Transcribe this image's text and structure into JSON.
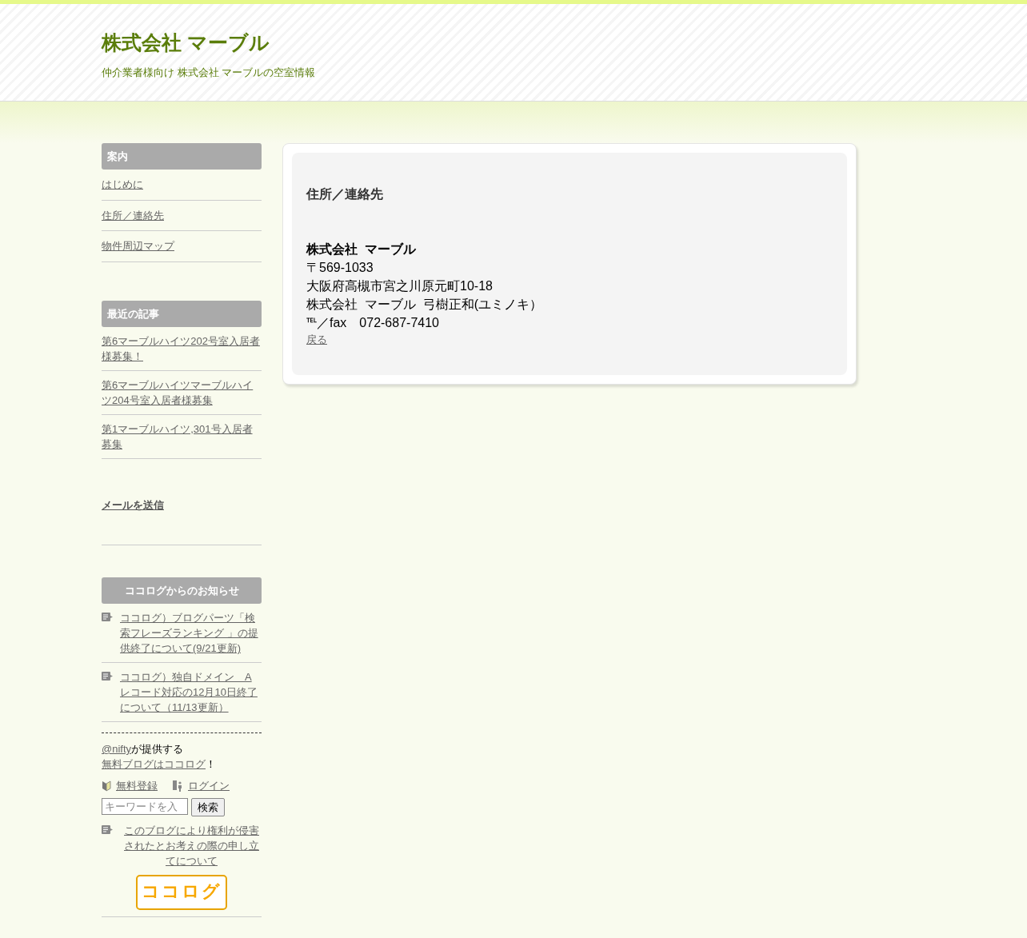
{
  "header": {
    "title": "株式会社 マーブル",
    "tagline": "仲介業者様向け 株式会社 マーブルの空室情報"
  },
  "sidebar": {
    "guide": {
      "title": "案内",
      "items": [
        "はじめに",
        "住所／連絡先",
        "物件周辺マップ"
      ]
    },
    "recent": {
      "title": "最近の記事",
      "items": [
        "第6マーブルハイツ202号室入居者様募集！",
        "第6マーブルハイツマーブルハイツ204号室入居者様募集",
        "第1マーブルハイツ,301号入居者募集"
      ]
    },
    "mail_link": "メールを送信",
    "notices": {
      "title": "ココログからのお知らせ",
      "items": [
        "ココログ）ブログパーツ「検索フレーズランキング 」の提供終了について(9/21更新)",
        "ココログ）独自ドメイン　Aレコード対応の12月10日終了について（11/13更新）"
      ]
    },
    "provider": {
      "link": "@nifty",
      "text": "が提供する"
    },
    "free_blog": {
      "link": "無料ブログはココログ",
      "text": "！"
    },
    "register": "無料登録",
    "login": "ログイン",
    "search": {
      "placeholder": "キーワードを入",
      "button": "検索"
    },
    "report_link": "このブログにより権利が侵害されたとお考えの際の申し立てについて",
    "logo": "ココログ"
  },
  "main": {
    "heading": "住所／連絡先",
    "company": "株式会社  マーブル",
    "lines": [
      "〒569-1033",
      "大阪府高槻市宮之川原元町10-18",
      "株式会社  マーブル  弓樹正和(ユミノキ）",
      "℡／fax　072-687-7410"
    ],
    "back": "戻る"
  }
}
